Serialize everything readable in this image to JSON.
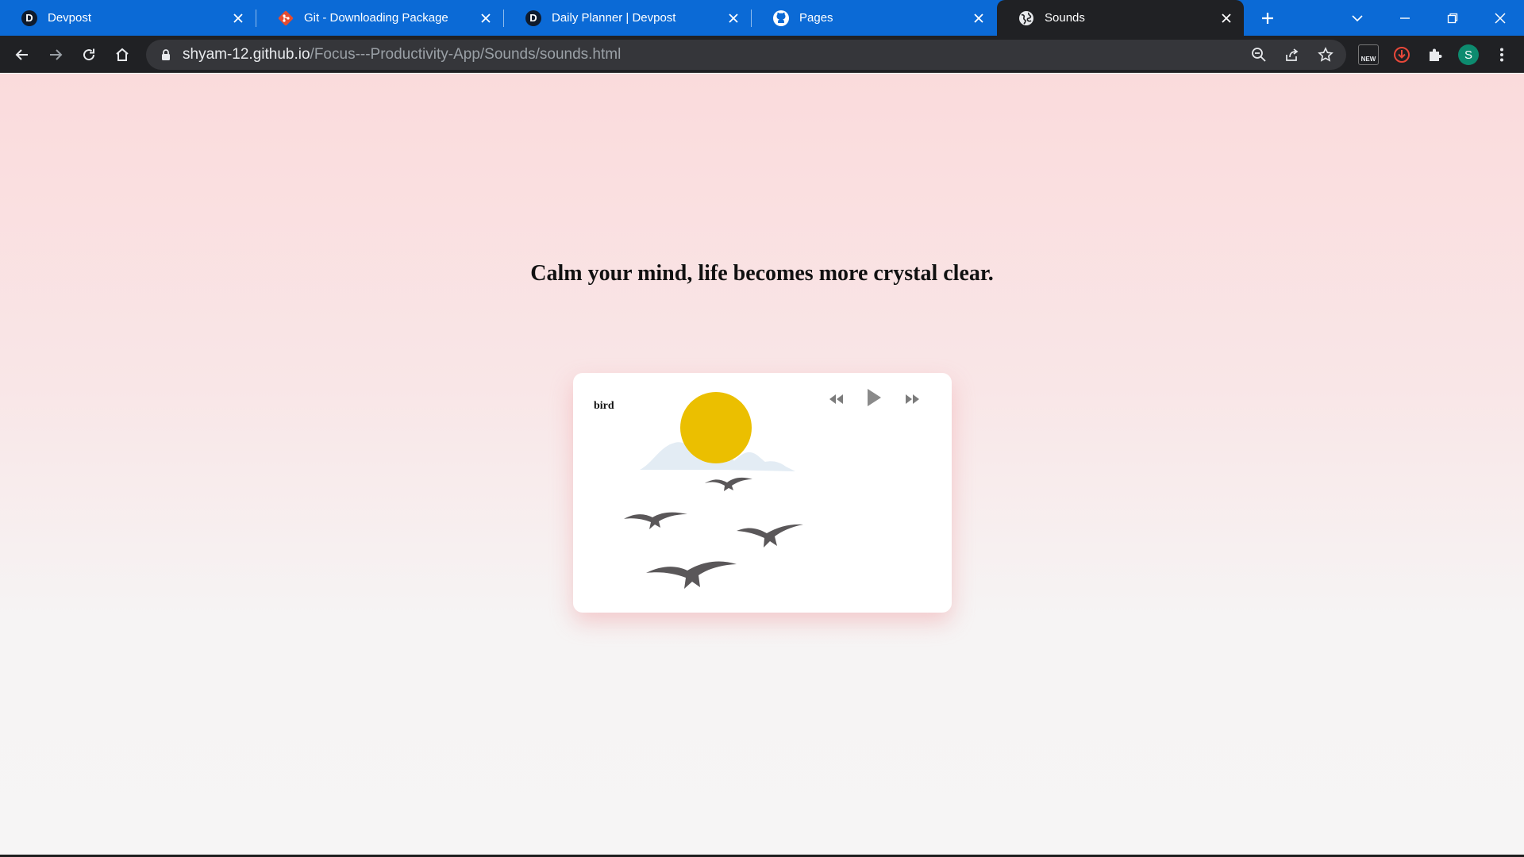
{
  "browser": {
    "tabs": [
      {
        "title": "Devpost",
        "favicon": "devpost-icon",
        "active": false
      },
      {
        "title": "Git - Downloading Package",
        "favicon": "git-icon",
        "active": false
      },
      {
        "title": "Daily Planner | Devpost",
        "favicon": "devpost-icon",
        "active": false
      },
      {
        "title": "Pages",
        "favicon": "github-icon",
        "active": false
      },
      {
        "title": "Sounds",
        "favicon": "globe-icon",
        "active": true
      }
    ],
    "address": {
      "host": "shyam-12.github.io",
      "path": "/Focus---Productivity-App/Sounds/sounds.html"
    },
    "extension_badge": "NEW",
    "profile_initial": "S",
    "colors": {
      "tabstrip": "#0b6ad6",
      "toolbar": "#202124",
      "omnibox": "#35363a",
      "avatar": "#0d8b6f"
    }
  },
  "page": {
    "headline": "Calm your mind, life becomes more crystal clear.",
    "player": {
      "sound_name": "bird",
      "controls": [
        "rewind-icon",
        "play-icon",
        "fast-forward-icon"
      ],
      "illustration": "sun-clouds-birds-illustration"
    },
    "colors": {
      "sun": "#ebbf00",
      "clouds": "#e3ecf4",
      "birds": "#5a5759",
      "controls": "#808080"
    }
  }
}
